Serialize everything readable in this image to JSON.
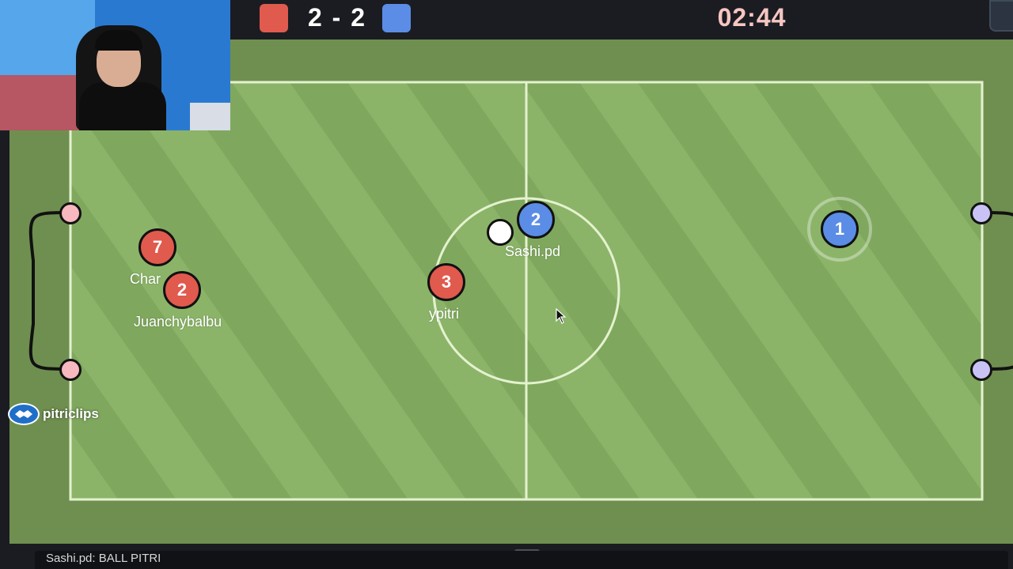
{
  "scoreboard": {
    "score": "2 - 2",
    "red_goals": 2,
    "blue_goals": 2,
    "timer": "02:44",
    "red_color": "#e05a4e",
    "blue_color": "#5b8de6"
  },
  "players": [
    {
      "number": "7",
      "team": "red",
      "name": "Char"
    },
    {
      "number": "2",
      "team": "red",
      "name": "Juanchybalbu"
    },
    {
      "number": "3",
      "team": "red",
      "name": "ypitri"
    },
    {
      "number": "2",
      "team": "blue",
      "name": "Sashi.pd"
    },
    {
      "number": "1",
      "team": "blue",
      "name": ""
    }
  ],
  "watermark": {
    "text": "pitriclips",
    "icon": "handshake-icon"
  },
  "chat": {
    "text": "Sashi.pd: BALL PITRI"
  },
  "pitch": {
    "grass_color": "#7aa35a",
    "stripe_color": "#88b266",
    "line_color": "#dff0c8"
  }
}
